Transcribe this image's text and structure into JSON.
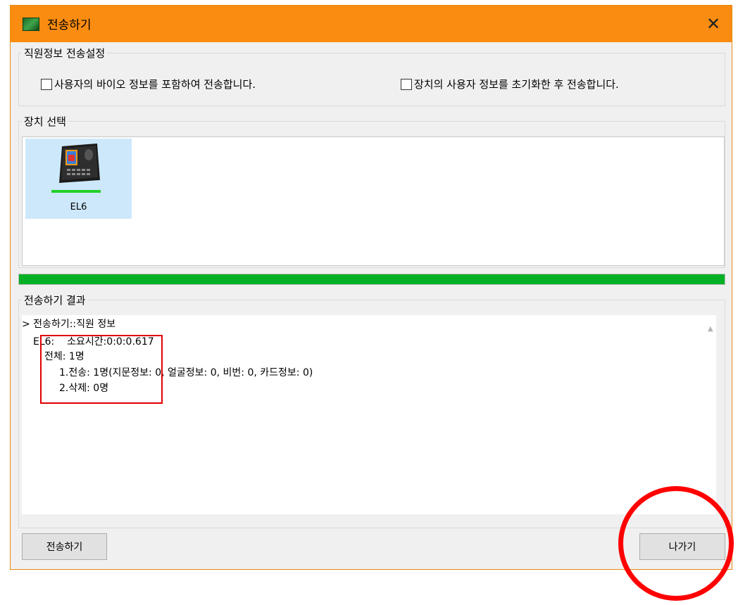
{
  "window": {
    "title": "전송하기"
  },
  "employee_settings": {
    "legend": "직원정보 전송설정",
    "include_bio_label": "사용자의 바이오 정보를 포함하여 전송합니다.",
    "init_device_users_label": "장치의 사용자 정보를 초기화한 후 전송합니다."
  },
  "device_select": {
    "legend": "장치 선택",
    "devices": [
      {
        "name": "EL6",
        "selected": true
      }
    ]
  },
  "progress": {
    "percent": 100,
    "color": "#06b025"
  },
  "result": {
    "legend": "전송하기 결과",
    "lines": [
      "> 전송하기::직원 정보",
      "EL6:    소요시간:0:0:0.617",
      "전체: 1명",
      "1.전송: 1명(지문정보: 0, 얼굴정보: 0, 비번: 0, 카드정보: 0)",
      "2.삭제: 0명"
    ]
  },
  "buttons": {
    "send": "전송하기",
    "exit": "나가기"
  },
  "colors": {
    "titlebar": "#fa8c12",
    "annotation": "#ff0000"
  }
}
